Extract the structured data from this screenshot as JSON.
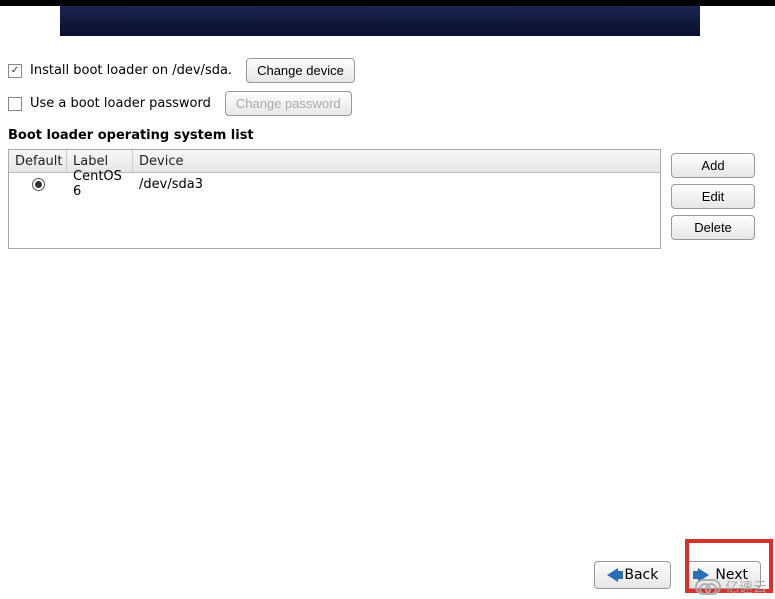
{
  "install_checkbox": {
    "checked": true,
    "label": "Install boot loader on /dev/sda."
  },
  "change_device_label": "Change device",
  "password_checkbox": {
    "checked": false,
    "label": "Use a boot loader password"
  },
  "change_password_label": "Change password",
  "section_title": "Boot loader operating system list",
  "table": {
    "headers": {
      "default": "Default",
      "label": "Label",
      "device": "Device"
    },
    "rows": [
      {
        "selected": true,
        "label": "CentOS 6",
        "device": "/dev/sda3"
      }
    ]
  },
  "side": {
    "add": "Add",
    "edit": "Edit",
    "delete": "Delete"
  },
  "footer": {
    "back": "Back",
    "next": "Next"
  },
  "watermark": "亿速云"
}
